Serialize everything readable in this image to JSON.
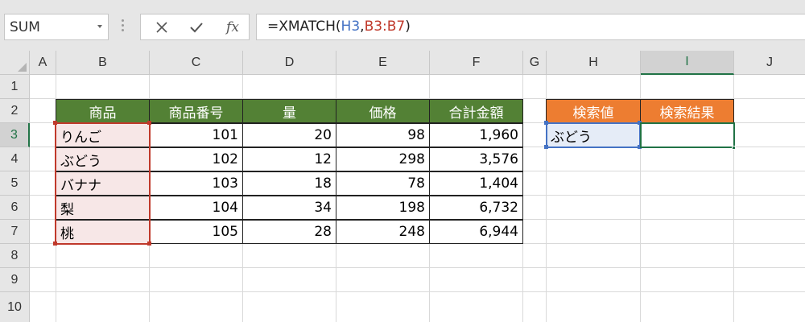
{
  "name_box": {
    "value": "SUM"
  },
  "formula_bar": {
    "fx_label": "fx",
    "formula_prefix": "=XMATCH(",
    "ref1": "H3",
    "comma": ",",
    "ref2": "B3:B7",
    "formula_suffix": ")"
  },
  "columns": [
    "A",
    "B",
    "C",
    "D",
    "E",
    "F",
    "G",
    "H",
    "I",
    "J"
  ],
  "rows": [
    "1",
    "2",
    "3",
    "4",
    "5",
    "6",
    "7",
    "8",
    "9",
    "10"
  ],
  "selected_column": "I",
  "selected_row": "3",
  "table": {
    "headers": [
      "商品",
      "商品番号",
      "量",
      "価格",
      "合計金額"
    ],
    "rows": [
      [
        "りんご",
        "101",
        "20",
        "98",
        "1,960"
      ],
      [
        "ぶどう",
        "102",
        "12",
        "298",
        "3,576"
      ],
      [
        "バナナ",
        "103",
        "18",
        "78",
        "1,404"
      ],
      [
        "梨",
        "104",
        "34",
        "198",
        "6,732"
      ],
      [
        "桃",
        "105",
        "28",
        "248",
        "6,944"
      ]
    ]
  },
  "lookup": {
    "headers": [
      "検索値",
      "検索結果"
    ],
    "value": "ぶどう",
    "result": ""
  },
  "colors": {
    "table_header": "#538135",
    "lookup_header": "#ed7d31",
    "ref_red": "#c0392b",
    "ref_blue": "#4472c4",
    "active_green": "#217346"
  }
}
